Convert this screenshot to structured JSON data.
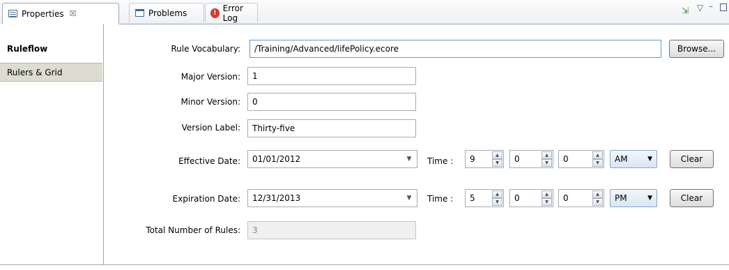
{
  "tabs": [
    {
      "label": "Properties",
      "close": "☒"
    },
    {
      "label": "Problems"
    },
    {
      "label": "Error Log"
    }
  ],
  "side_tabs": {
    "ruleflow": "Ruleflow",
    "rulers": "Rulers & Grid"
  },
  "form": {
    "vocab_label": "Rule Vocabulary:",
    "vocab_value": "/Training/Advanced/lifePolicy.ecore",
    "browse": "Browse...",
    "major_label": "Major Version:",
    "major_value": "1",
    "minor_label": "Minor Version:",
    "minor_value": "0",
    "verlabel_label": "Version Label:",
    "verlabel_value": "Thirty-five",
    "eff_label": "Effective Date:",
    "eff_value": "01/01/2012",
    "exp_label": "Expiration Date:",
    "exp_value": "12/31/2013",
    "time_label": "Time :",
    "eff_hour": "9",
    "eff_min": "0",
    "eff_sec": "0",
    "eff_ampm": "AM",
    "exp_hour": "5",
    "exp_min": "0",
    "exp_sec": "0",
    "exp_ampm": "PM",
    "clear": "Clear",
    "total_label": "Total Number of Rules:",
    "total_value": "3"
  }
}
